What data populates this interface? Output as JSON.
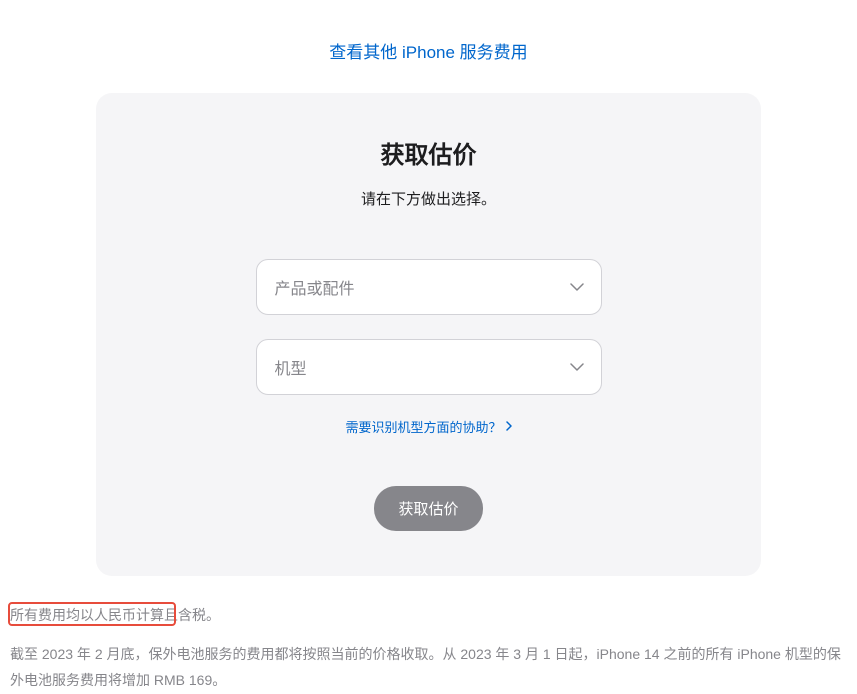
{
  "topLink": {
    "text": "查看其他 iPhone 服务费用"
  },
  "card": {
    "title": "获取估价",
    "subtitle": "请在下方做出选择。",
    "select1Placeholder": "产品或配件",
    "select2Placeholder": "机型",
    "helpLink": "需要识别机型方面的协助？",
    "submitLabel": "获取估价"
  },
  "footer": {
    "line1": "所有费用均以人民币计算且含税。",
    "line2": "截至 2023 年 2 月底，保外电池服务的费用都将按照当前的价格收取。从 2023 年 3 月 1 日起，iPhone 14 之前的所有 iPhone 机型的保外电池服务费用将增加 RMB 169。"
  }
}
